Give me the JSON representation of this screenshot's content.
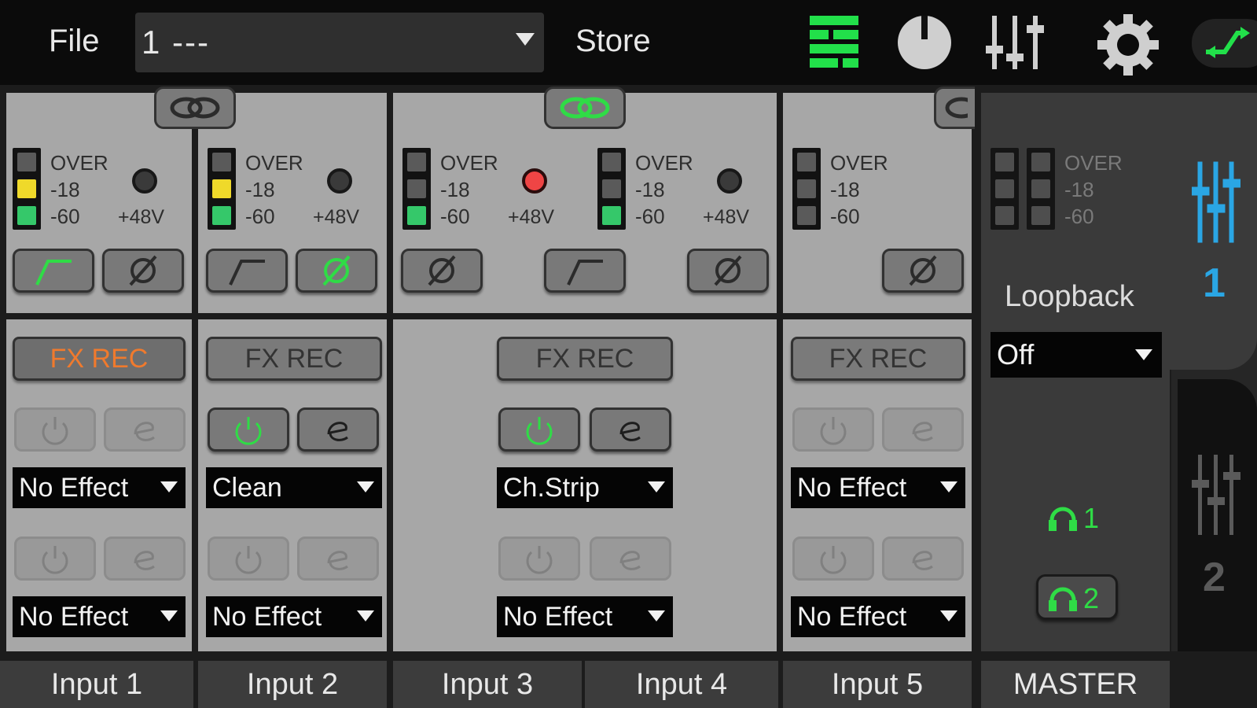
{
  "topbar": {
    "file_label": "File",
    "preset_value": "1 ---",
    "store_label": "Store",
    "icons": [
      "mixer-view-icon",
      "gain-knob-icon",
      "faders-icon",
      "settings-gear-icon",
      "routing-icon"
    ],
    "accent_color": "#22e04a"
  },
  "meter_labels": {
    "over": "OVER",
    "mid": "-18",
    "low": "-60",
    "phantom": "+48V"
  },
  "channels": [
    {
      "label": "Input 1",
      "fx_rec": "FX REC",
      "fx1": "No Effect",
      "fx2": "No Effect"
    },
    {
      "label": "Input 2",
      "fx_rec": "FX REC",
      "fx1": "Clean",
      "fx2": "No Effect"
    },
    {
      "label": "Input 3",
      "fx_rec": "FX REC",
      "fx1": "Ch.Strip",
      "fx2": "No Effect"
    },
    {
      "label": "Input 4"
    },
    {
      "label": "Input 5",
      "fx_rec": "FX REC",
      "fx1": "No Effect",
      "fx2": "No Effect"
    }
  ],
  "master": {
    "label": "MASTER",
    "loopback_label": "Loopback",
    "loopback_value": "Off",
    "hp1": "1",
    "hp2": "2"
  },
  "tabs": {
    "tab1": "1",
    "tab2": "2",
    "tab1_color": "#2aa6e4",
    "tab2_color": "#5a5a5a"
  }
}
